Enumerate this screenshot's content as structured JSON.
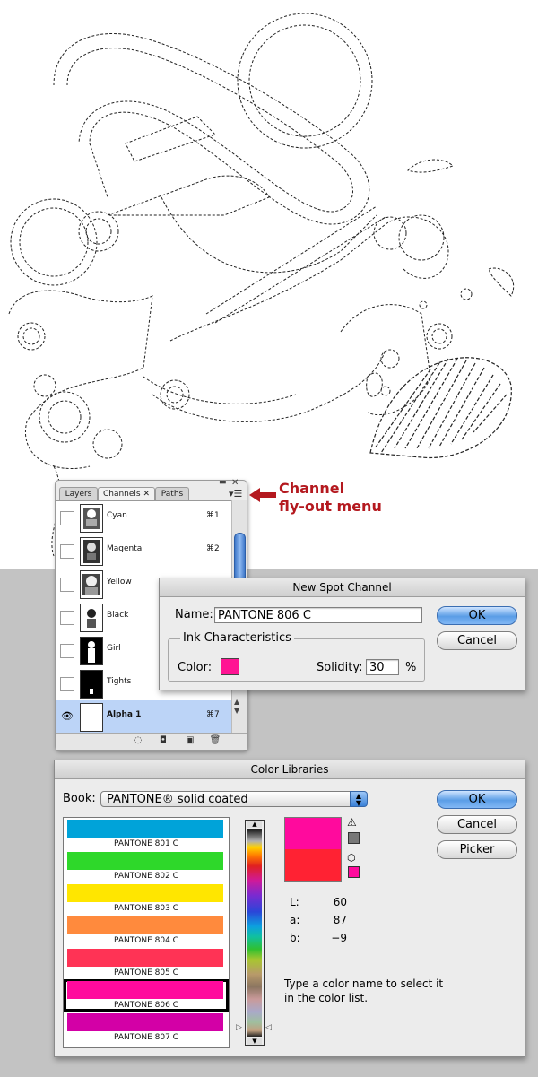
{
  "channels_panel": {
    "tabs": [
      "Layers",
      "Channels",
      "Paths"
    ],
    "rows": [
      {
        "name": "Cyan",
        "shortcut": "⌘1",
        "visible": false
      },
      {
        "name": "Magenta",
        "shortcut": "⌘2",
        "visible": false
      },
      {
        "name": "Yellow",
        "shortcut": "",
        "visible": false
      },
      {
        "name": "Black",
        "shortcut": "",
        "visible": false
      },
      {
        "name": "Girl",
        "shortcut": "",
        "visible": false
      },
      {
        "name": "Tights",
        "shortcut": "",
        "visible": false
      },
      {
        "name": "Alpha 1",
        "shortcut": "⌘7",
        "visible": true,
        "selected": true
      }
    ],
    "close_glyph": "✕",
    "menu_icon": "menu-lines-icon"
  },
  "annotation": {
    "line1": "Channel",
    "line2": "fly-out menu",
    "color": "#b4191f"
  },
  "new_spot_channel": {
    "title": "New Spot Channel",
    "name_label": "Name:",
    "name_value": "PANTONE 806 C",
    "group_title": "Ink Characteristics",
    "color_label": "Color:",
    "color_value": "#ff1493",
    "solidity_label": "Solidity:",
    "solidity_value": "30",
    "solidity_unit": "%",
    "ok_label": "OK",
    "cancel_label": "Cancel"
  },
  "color_libraries": {
    "title": "Color Libraries",
    "book_label": "Book:",
    "book_value": "PANTONE® solid coated",
    "swatches": [
      {
        "name": "PANTONE 801 C",
        "color": "#00a3d9"
      },
      {
        "name": "PANTONE 802 C",
        "color": "#2ed82a"
      },
      {
        "name": "PANTONE 803 C",
        "color": "#ffe600"
      },
      {
        "name": "PANTONE 804 C",
        "color": "#ff8a3d"
      },
      {
        "name": "PANTONE 805 C",
        "color": "#ff3355"
      },
      {
        "name": "PANTONE 806 C",
        "color": "#ff0a9d",
        "selected": true
      },
      {
        "name": "PANTONE 807 C",
        "color": "#d300a6"
      }
    ],
    "preview_new": "#ff0a9d",
    "preview_old": "#ff2233",
    "web_swatch": "#ff0a9d",
    "lab": {
      "L_label": "L:",
      "L": "60",
      "a_label": "a:",
      "a": "87",
      "b_label": "b:",
      "b": "−9"
    },
    "hint": "Type a color name to select it in the color list.",
    "ok_label": "OK",
    "cancel_label": "Cancel",
    "picker_label": "Picker"
  }
}
